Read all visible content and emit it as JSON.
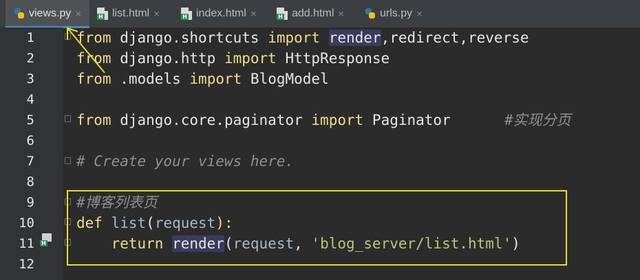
{
  "tabs": [
    {
      "label": "views.py",
      "icon": "python-file-icon",
      "active": true
    },
    {
      "label": "list.html",
      "icon": "html-file-icon",
      "active": false
    },
    {
      "label": "index.html",
      "icon": "html-file-icon",
      "active": false
    },
    {
      "label": "add.html",
      "icon": "html-file-icon",
      "active": false
    },
    {
      "label": "urls.py",
      "icon": "python-file-icon",
      "active": false
    }
  ],
  "tab_close_glyph": "×",
  "html_icon_badge": "H",
  "line_numbers": [
    "1",
    "2",
    "3",
    "4",
    "5",
    "6",
    "7",
    "8",
    "9",
    "10",
    "11",
    "12"
  ],
  "code": {
    "l1": {
      "from": "from",
      "mod": "django.shortcuts",
      "import": "import",
      "name": "render",
      "rest": ",redirect,reverse"
    },
    "l2": {
      "from": "from",
      "mod": "django.http",
      "import": "import",
      "rest": "HttpResponse"
    },
    "l3": {
      "from": "from",
      "mod": ".models",
      "import": "import",
      "rest": "BlogModel"
    },
    "l5": {
      "from": "from",
      "mod": "django.core.paginator",
      "import": "import",
      "rest": "Paginator",
      "comment": "#实现分页"
    },
    "l7": {
      "comment": "# Create your views here."
    },
    "l9": {
      "comment": "#博客列表页"
    },
    "l10": {
      "def": "def",
      "name": "list",
      "open": "(",
      "param": "request",
      "close": "):"
    },
    "l11": {
      "return": "return",
      "call": "render",
      "open": "(",
      "arg": "request",
      "sep": ", ",
      "str": "'blog_server/list.html'",
      "close": ")"
    }
  },
  "colors": {
    "keyword": "#f0dc8c",
    "comment": "#8f8f8f",
    "string": "#b8c878",
    "annotation": "#e8e022",
    "active_tab_underline": "#4a88c7"
  }
}
